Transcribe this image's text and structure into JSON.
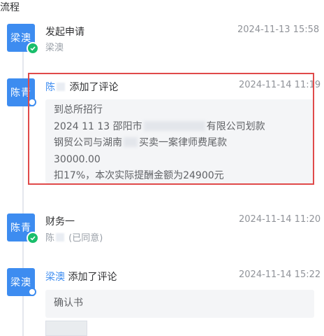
{
  "section_title": "流程",
  "timeline": [
    {
      "avatar": "梁澳",
      "title": "发起申请",
      "subtitle": "梁澳",
      "time": "2024-11-13 15:58",
      "status": "done"
    },
    {
      "avatar": "陈青",
      "actor": "陈",
      "action": "添加了评论",
      "time": "2024-11-14 11:19",
      "status": "pending",
      "comment_lines": [
        "到总所招行",
        "2024  11  13    邵阳市",
        "有限公司划款",
        "钢贸公司与湖南",
        "买卖一案律师费尾款",
        "30000.00",
        "扣17%，本次实际提酬金额为24900元"
      ]
    },
    {
      "avatar": "陈青",
      "title": "财务一",
      "subtitle_name": "陈",
      "subtitle_status": "(已同意)",
      "time": "2024-11-14 11:20",
      "status": "done"
    },
    {
      "avatar": "梁澳",
      "actor": "梁澳",
      "action": "添加了评论",
      "time": "2024-11-14 15:22",
      "status": "pending",
      "comment_lines": [
        "确认书"
      ]
    }
  ],
  "colors": {
    "avatar_bg": "#3d8cf0",
    "done_badge": "#19be6b",
    "highlight_border": "#e04a4a",
    "link": "#3d8cf0"
  }
}
